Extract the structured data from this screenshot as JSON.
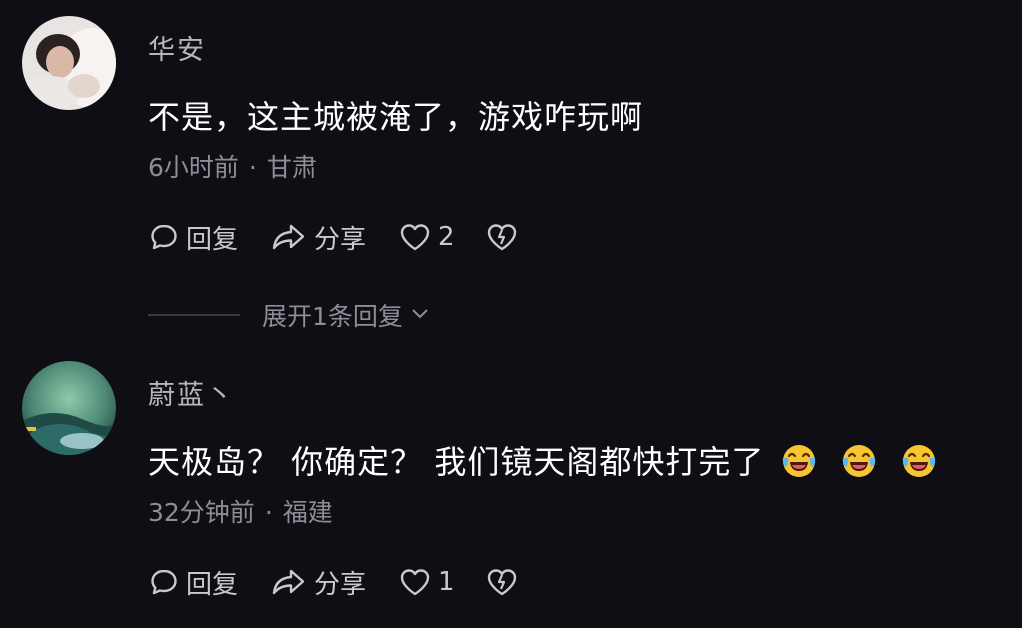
{
  "comments": [
    {
      "username": "华安",
      "text": "不是，这主城被淹了，游戏咋玩啊",
      "time": "6小时前",
      "location": "甘肃",
      "reply_label": "回复",
      "share_label": "分享",
      "like_count": "2",
      "expand_label": "展开1条回复"
    },
    {
      "username": "蔚蓝丶",
      "text": "天极岛？ 你确定？ 我们镜天阁都快打完了",
      "emojis": [
        "laugh-cry-icon",
        "laugh-cry-icon",
        "laugh-cry-icon"
      ],
      "time": "32分钟前",
      "location": "福建",
      "reply_label": "回复",
      "share_label": "分享",
      "like_count": "1"
    }
  ],
  "separator": "·",
  "colors": {
    "background": "#0e0e14",
    "primary_text": "#ffffff",
    "secondary_text": "#8d8d96",
    "username_text": "#b6b6bd",
    "action_text": "#c8c8cf"
  }
}
